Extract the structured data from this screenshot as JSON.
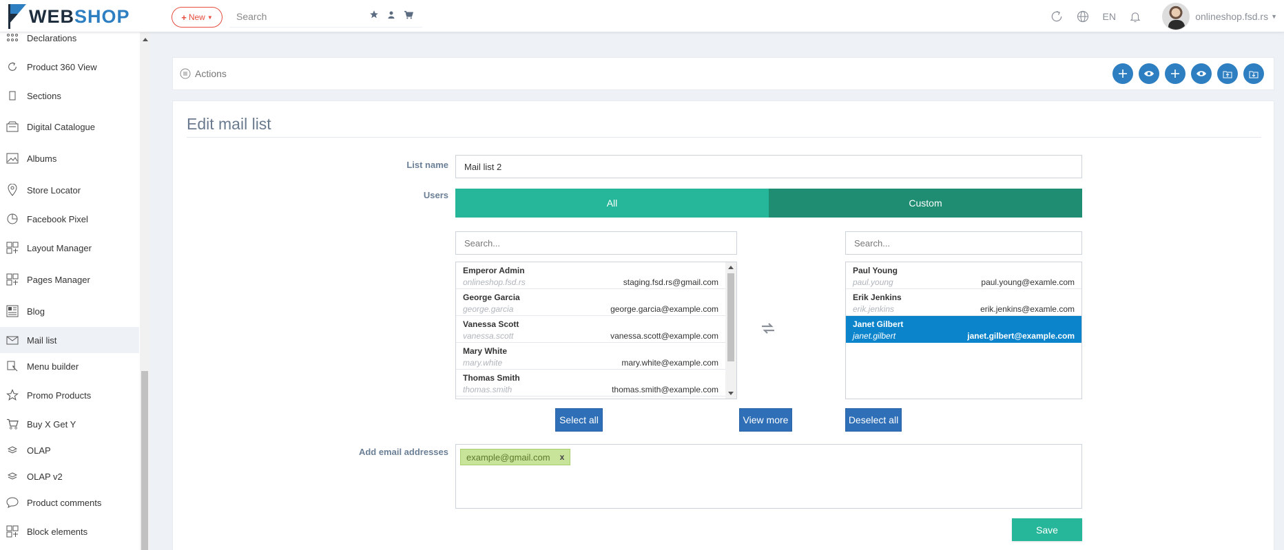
{
  "brand": {
    "part1": "WEB",
    "part2": "SHOP",
    "accent": "#2e7fc2"
  },
  "topbar": {
    "new_label": "New",
    "search_placeholder": "Search",
    "language": "EN",
    "profile_name": "onlineshop.fsd.rs",
    "icons": [
      "star-icon",
      "user-icon",
      "cart-icon",
      "refresh-icon",
      "globe-icon",
      "bell-icon"
    ]
  },
  "sidebar": {
    "items": [
      {
        "label": "Declarations",
        "icon": "grid-dots-icon"
      },
      {
        "label": "Product 360 View",
        "icon": "rotate-icon"
      },
      {
        "label": "Sections",
        "icon": "page-icon"
      },
      {
        "label": "Digital Catalogue",
        "icon": "catalogue-icon"
      },
      {
        "label": "Albums",
        "icon": "image-icon"
      },
      {
        "label": "Store Locator",
        "icon": "map-pin-icon"
      },
      {
        "label": "Facebook Pixel",
        "icon": "pie-icon"
      },
      {
        "label": "Layout Manager",
        "icon": "layout-icon"
      },
      {
        "label": "Pages Manager",
        "icon": "layout-icon"
      },
      {
        "label": "Blog",
        "icon": "blog-icon"
      },
      {
        "label": "Mail list",
        "icon": "envelope-icon"
      },
      {
        "label": "Menu builder",
        "icon": "menu-builder-icon"
      },
      {
        "label": "Promo Products",
        "icon": "star-outline-icon"
      },
      {
        "label": "Buy X Get Y",
        "icon": "cart-outline-icon"
      },
      {
        "label": "OLAP",
        "icon": "layers-icon"
      },
      {
        "label": "OLAP v2",
        "icon": "layers-icon"
      },
      {
        "label": "Product comments",
        "icon": "comment-icon"
      },
      {
        "label": "Block elements",
        "icon": "layout-icon"
      }
    ],
    "active_index": 10
  },
  "actions": {
    "title": "Actions"
  },
  "form": {
    "page_title": "Edit mail list",
    "list_name_label": "List name",
    "list_name_value": "Mail list 2",
    "users_label": "Users",
    "toggle_all": "All",
    "toggle_custom": "Custom",
    "search_placeholder_left": "Search...",
    "search_placeholder_right": "Search...",
    "available_users": [
      {
        "name": "Emperor Admin",
        "login": "onlineshop.fsd.rs",
        "email": "staging.fsd.rs@gmail.com"
      },
      {
        "name": "George Garcia",
        "login": "george.garcia",
        "email": "george.garcia@example.com"
      },
      {
        "name": "Vanessa Scott",
        "login": "vanessa.scott",
        "email": "vanessa.scott@example.com"
      },
      {
        "name": "Mary White",
        "login": "mary.white",
        "email": "mary.white@example.com"
      },
      {
        "name": "Thomas Smith",
        "login": "thomas.smith",
        "email": "thomas.smith@example.com"
      }
    ],
    "selected_users": [
      {
        "name": "Paul Young",
        "login": "paul.young",
        "email": "paul.young@examle.com"
      },
      {
        "name": "Erik Jenkins",
        "login": "erik.jenkins",
        "email": "erik.jenkins@examle.com"
      },
      {
        "name": "Janet Gilbert",
        "login": "janet.gilbert",
        "email": "janet.gilbert@example.com"
      }
    ],
    "highlighted_selected_index": 2,
    "select_all": "Select all",
    "view_more": "View more",
    "deselect_all": "Deselect all",
    "add_emails_label": "Add email addresses",
    "email_tags": [
      {
        "text": "example@gmail.com",
        "remove": "x"
      }
    ],
    "save": "Save"
  },
  "colors": {
    "teal": "#26b79a",
    "teal_dark": "#1f8d72",
    "blue": "#2e6fb7",
    "highlight": "#0b84cc"
  }
}
